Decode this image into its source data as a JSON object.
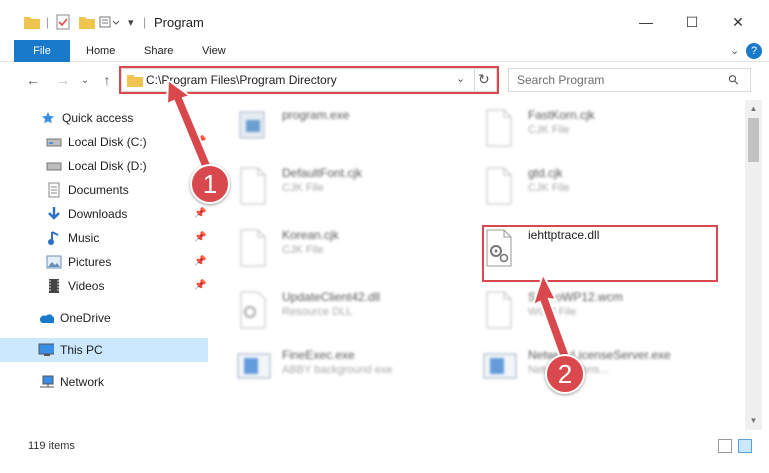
{
  "window": {
    "title": "Program",
    "minimize": "—",
    "maximize": "☐",
    "close": "✕"
  },
  "ribbon": {
    "file": "File",
    "home": "Home",
    "share": "Share",
    "view": "View"
  },
  "nav": {
    "back": "←",
    "forward": "→",
    "recent": "⌄",
    "up": "↑"
  },
  "address": {
    "path": "C:\\Program Files\\Program Directory",
    "dropdown": "⌄",
    "refresh": "↻"
  },
  "search": {
    "placeholder": "Search Program",
    "icon": "⚲"
  },
  "sidebar": {
    "items": [
      {
        "label": "Quick access",
        "icon": "star-icon",
        "pinned": false
      },
      {
        "label": "Local Disk (C:)",
        "icon": "drive-icon",
        "pinned": true
      },
      {
        "label": "Local Disk (D:)",
        "icon": "drive-icon",
        "pinned": false
      },
      {
        "label": "Documents",
        "icon": "documents-icon",
        "pinned": true
      },
      {
        "label": "Downloads",
        "icon": "download-icon",
        "pinned": true
      },
      {
        "label": "Music",
        "icon": "music-icon",
        "pinned": true
      },
      {
        "label": "Pictures",
        "icon": "pictures-icon",
        "pinned": true
      },
      {
        "label": "Videos",
        "icon": "videos-icon",
        "pinned": true
      },
      {
        "label": "OneDrive",
        "icon": "cloud-icon",
        "pinned": false
      },
      {
        "label": "This PC",
        "icon": "pc-icon",
        "pinned": false
      },
      {
        "label": "Network",
        "icon": "network-icon",
        "pinned": false
      }
    ],
    "pin_glyph": "📌"
  },
  "files": [
    {
      "name": "program.exe",
      "type": "",
      "icon": "exe-icon"
    },
    {
      "name": "FastKorn.cjk",
      "type": "CJK File",
      "icon": "file-icon"
    },
    {
      "name": "DefaultFont.cjk",
      "type": "CJK File",
      "icon": "file-icon"
    },
    {
      "name": "gtd.cjk",
      "type": "CJK File",
      "icon": "file-icon"
    },
    {
      "name": "Korean.cjk",
      "type": "CJK File",
      "icon": "file-icon"
    },
    {
      "name": "iehttptrace.dll",
      "type": "",
      "icon": "dll-icon"
    },
    {
      "name": "UpdateClient42.dll",
      "type": "Resource DLL",
      "icon": "dll-icon"
    },
    {
      "name": "ScanoWP12.wcm",
      "type": "WCM File",
      "icon": "file-icon"
    },
    {
      "name": "FineExec.exe",
      "type": "ABBY background exe",
      "icon": "app-icon"
    },
    {
      "name": "NetworkLicenseServer.exe",
      "type": "Network licens...",
      "icon": "app-icon"
    }
  ],
  "status": {
    "count": "119 items"
  },
  "callouts": {
    "one": "1",
    "two": "2"
  },
  "colors": {
    "accent": "#1979ca",
    "highlight": "#d9484d",
    "selected": "#cce8ff",
    "folder": "#f0c451"
  }
}
